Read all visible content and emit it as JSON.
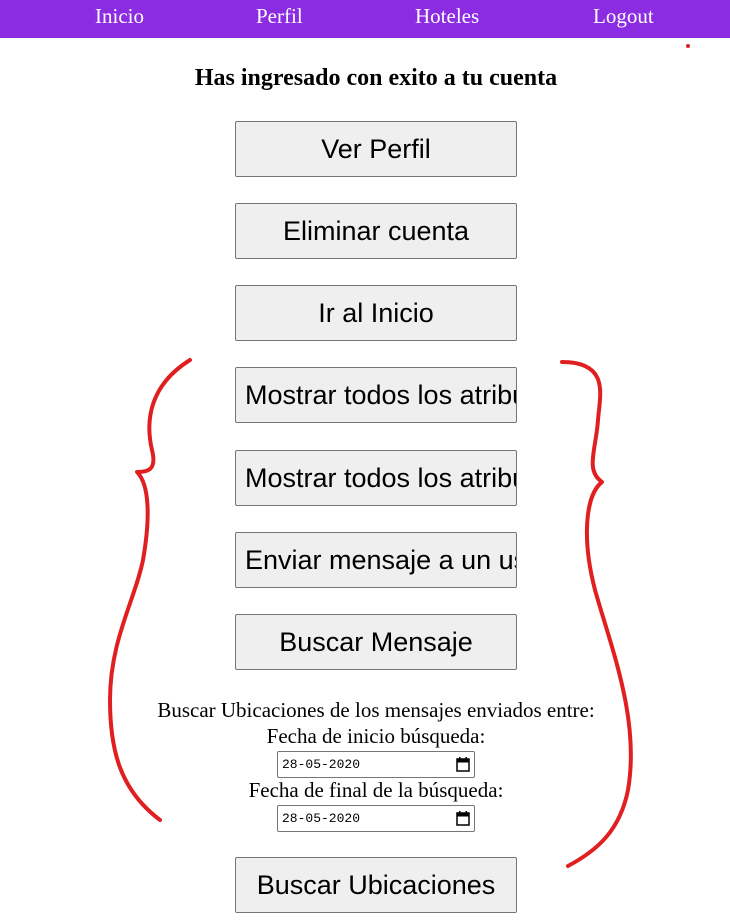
{
  "nav": {
    "items": [
      {
        "label": "Inicio"
      },
      {
        "label": "Perfil"
      },
      {
        "label": "Hoteles"
      },
      {
        "label": "Logout"
      }
    ]
  },
  "main": {
    "title": "Has ingresado con exito a tu cuenta",
    "buttons": {
      "ver_perfil": "Ver Perfil",
      "eliminar_cuenta": "Eliminar cuenta",
      "ir_inicio": "Ir al Inicio",
      "mostrar_atributos_1": "Mostrar todos los atributos",
      "mostrar_atributos_2": "Mostrar todos los atributos",
      "enviar_mensaje": "Enviar mensaje a un usuario",
      "buscar_mensaje": "Buscar Mensaje",
      "buscar_ubicaciones": "Buscar Ubicaciones"
    },
    "search": {
      "heading": "Buscar Ubicaciones de los mensajes enviados entre:",
      "start_label": "Fecha de inicio búsqueda:",
      "start_value": "28-05-2020",
      "end_label": "Fecha de final de la búsqueda:",
      "end_value": "28-05-2020"
    }
  },
  "colors": {
    "navbar": "#8b2be2",
    "annotation": "#e02020"
  }
}
